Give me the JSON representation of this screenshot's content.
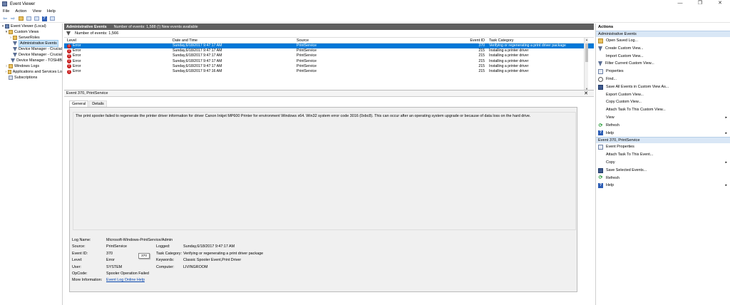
{
  "window": {
    "title": "Event Viewer",
    "minimize": "—",
    "maximize": "❐",
    "close": "✕"
  },
  "menu": [
    "File",
    "Action",
    "View",
    "Help"
  ],
  "tree": [
    {
      "label": "Event Viewer (Local)",
      "level": 0,
      "expander": "▾",
      "icon": "computer"
    },
    {
      "label": "Custom Views",
      "level": 1,
      "expander": "▾",
      "icon": "folder"
    },
    {
      "label": "ServerRoles",
      "level": 2,
      "expander": "›",
      "icon": "folder"
    },
    {
      "label": "Administrative Events",
      "level": 2,
      "expander": "",
      "icon": "filter",
      "selected": true
    },
    {
      "label": "Device Manager - Crucial",
      "level": 2,
      "expander": "",
      "icon": "filter"
    },
    {
      "label": "Device Manager - Crucial",
      "level": 2,
      "expander": "",
      "icon": "filter"
    },
    {
      "label": "Device Manager - TOSHIB",
      "level": 2,
      "expander": "",
      "icon": "filter"
    },
    {
      "label": "Windows Logs",
      "level": 1,
      "expander": "›",
      "icon": "folder"
    },
    {
      "label": "Applications and Services Lo",
      "level": 1,
      "expander": "›",
      "icon": "folder"
    },
    {
      "label": "Subscriptions",
      "level": 1,
      "expander": "",
      "icon": "log"
    }
  ],
  "main": {
    "header_title": "Administrative Events",
    "header_info": "Number of events: 1,588 (!) New events available",
    "filter_text": "Number of events: 1,566",
    "columns": {
      "level": "Level",
      "date": "Date and Time",
      "source": "Source",
      "event_id": "Event ID",
      "task": "Task Category"
    },
    "rows": [
      {
        "level": "Error",
        "date": "Sunday,6/18/2017 9:47:17 AM",
        "source": "PrintService",
        "event_id": "370",
        "task": "Verifying or regenerating a print driver package",
        "selected": true
      },
      {
        "level": "Error",
        "date": "Sunday,6/18/2017 9:47:17 AM",
        "source": "PrintService",
        "event_id": "215",
        "task": "Installing a printer driver"
      },
      {
        "level": "Error",
        "date": "Sunday,6/18/2017 9:47:17 AM",
        "source": "PrintService",
        "event_id": "215",
        "task": "Installing a printer driver"
      },
      {
        "level": "Error",
        "date": "Sunday,6/18/2017 9:47:17 AM",
        "source": "PrintService",
        "event_id": "215",
        "task": "Installing a printer driver"
      },
      {
        "level": "Error",
        "date": "Sunday,6/18/2017 9:47:17 AM",
        "source": "PrintService",
        "event_id": "215",
        "task": "Installing a printer driver"
      },
      {
        "level": "Error",
        "date": "Sunday,6/18/2017 9:47:16 AM",
        "source": "PrintService",
        "event_id": "215",
        "task": "Installing a printer driver"
      }
    ]
  },
  "detail": {
    "title": "Event 370, PrintService",
    "close": "✕",
    "tabs": [
      "General",
      "Details"
    ],
    "description": "The print spooler failed to regenerate the printer driver information for driver Canon Inkjet MP600 Printer for environment Windows x64. Win32 system error code 3016 (0xbc8). This can occur after an operating system upgrade or because of data loss on the hard drive.",
    "labels": {
      "log_name": "Log Name:",
      "source": "Source:",
      "event_id": "Event ID:",
      "level": "Level:",
      "user": "User:",
      "opcode": "OpCode:",
      "more_info": "More Information:",
      "logged": "Logged:",
      "task_category": "Task Category:",
      "keywords": "Keywords:",
      "computer": "Computer:"
    },
    "values": {
      "log_name": "Microsoft-Windows-PrintService/Admin",
      "source": "PrintService",
      "event_id": "370",
      "level": "Error",
      "user": "SYSTEM",
      "opcode": "Spooler Operation Failed",
      "more_info": "Event Log Online Help",
      "logged": "Sunday,6/18/2017 9:47:17 AM",
      "task_category": "Verifying or regenerating a print driver package",
      "keywords": "Classic Spooler Event,Print Driver",
      "computer": "LIVINGROOM"
    },
    "tooltip": "370"
  },
  "actions": {
    "title": "Actions",
    "section1": "Administrative Events",
    "items1": [
      {
        "label": "Open Saved Log...",
        "icon": "folder",
        "arrow": ""
      },
      {
        "label": "Create Custom View...",
        "icon": "filter",
        "arrow": ""
      },
      {
        "label": "Import Custom View...",
        "icon": "none",
        "arrow": ""
      },
      {
        "label": "Filter Current Custom View...",
        "icon": "filter",
        "arrow": ""
      },
      {
        "label": "Properties",
        "icon": "prop",
        "arrow": ""
      },
      {
        "label": "Find...",
        "icon": "find",
        "arrow": ""
      },
      {
        "label": "Save All Events in Custom View As...",
        "icon": "save",
        "arrow": ""
      },
      {
        "label": "Export Custom View...",
        "icon": "none",
        "arrow": ""
      },
      {
        "label": "Copy Custom View...",
        "icon": "none",
        "arrow": ""
      },
      {
        "label": "Attach Task To This Custom View...",
        "icon": "none",
        "arrow": ""
      },
      {
        "label": "View",
        "icon": "none",
        "arrow": "▸"
      },
      {
        "label": "Refresh",
        "icon": "refresh",
        "arrow": ""
      },
      {
        "label": "Help",
        "icon": "help",
        "arrow": "▸"
      }
    ],
    "section2": "Event 370, PrintService",
    "items2": [
      {
        "label": "Event Properties",
        "icon": "prop",
        "arrow": ""
      },
      {
        "label": "Attach Task To This Event...",
        "icon": "none",
        "arrow": ""
      },
      {
        "label": "Copy",
        "icon": "none",
        "arrow": "▸"
      },
      {
        "label": "Save Selected Events...",
        "icon": "save",
        "arrow": ""
      },
      {
        "label": "Refresh",
        "icon": "refresh",
        "arrow": ""
      },
      {
        "label": "Help",
        "icon": "help",
        "arrow": "▸"
      }
    ]
  }
}
